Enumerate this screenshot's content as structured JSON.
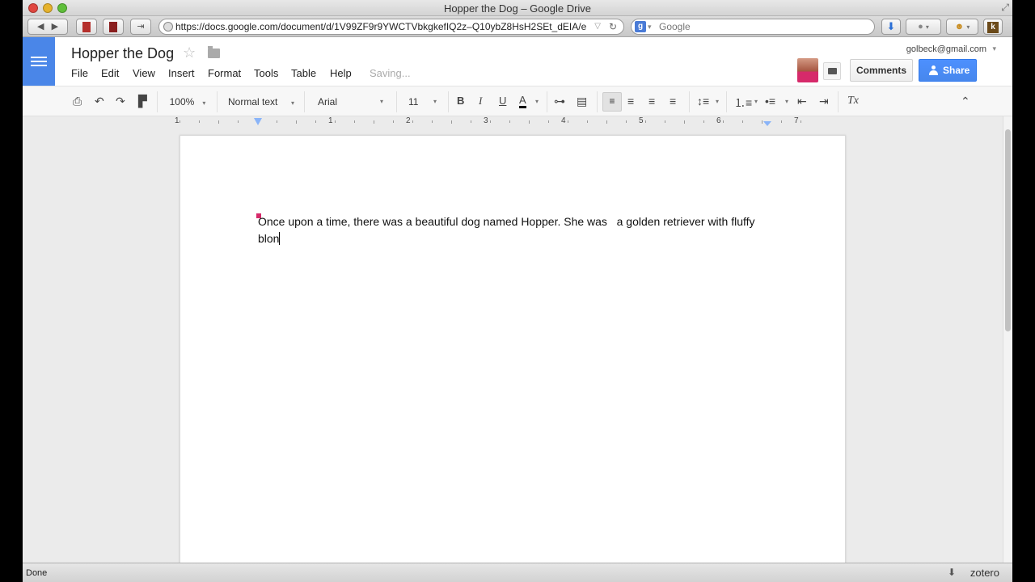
{
  "window": {
    "title": "Hopper the Dog – Google Drive"
  },
  "browser": {
    "url": "https://docs.google.com/document/d/1V99ZF9r9YWCTVbkgkefIQ2z–Q10ybZ8HsH2SEt_dEIA/e",
    "search_placeholder": "Google"
  },
  "docs": {
    "title": "Hopper the Dog",
    "menu": [
      "File",
      "Edit",
      "View",
      "Insert",
      "Format",
      "Tools",
      "Table",
      "Help"
    ],
    "save_status": "Saving...",
    "account_email": "golbeck@gmail.com",
    "comments_label": "Comments",
    "share_label": "Share"
  },
  "toolbar": {
    "zoom": "100%",
    "style": "Normal text",
    "font": "Arial",
    "font_size": "11"
  },
  "ruler": {
    "numbers": [
      "1",
      "1",
      "2",
      "3",
      "4",
      "5",
      "6",
      "7"
    ]
  },
  "document": {
    "text": "Once upon a time, there was a beautiful dog named Hopper. She was   a golden retriever with fluffy blon"
  },
  "status": {
    "text": "Done",
    "zotero": "zotero"
  },
  "colors": {
    "docs_blue": "#4a86e8",
    "share_blue": "#4d90fe",
    "collaborator": "#d62a6a"
  }
}
